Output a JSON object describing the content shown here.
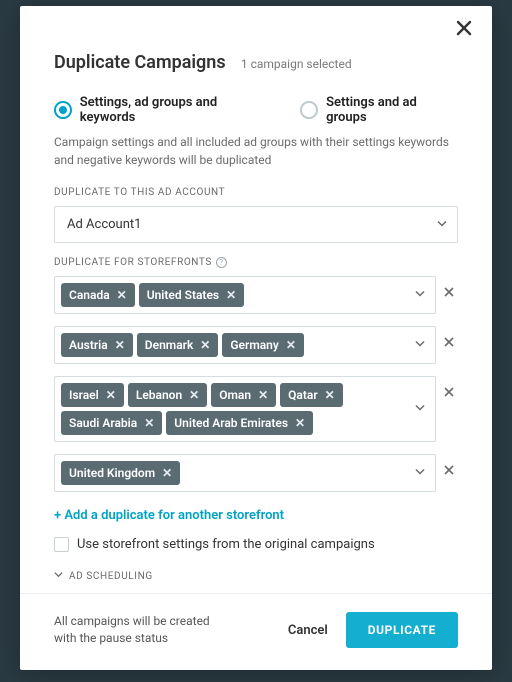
{
  "header": {
    "title": "Duplicate Campaigns",
    "subtitle": "1 campaign selected"
  },
  "radio": {
    "opt1": "Settings, ad groups and keywords",
    "opt2": "Settings and ad groups"
  },
  "description": "Campaign settings and all included ad groups with their settings  keywords and negative keywords will be duplicated",
  "account": {
    "label": "DUPLICATE TO THIS AD ACCOUNT",
    "value": "Ad Account1"
  },
  "storefronts": {
    "label": "DUPLICATE FOR STOREFRONTS",
    "rows": [
      [
        "Canada",
        "United States"
      ],
      [
        "Austria",
        "Denmark",
        "Germany"
      ],
      [
        "Israel",
        "Lebanon",
        "Oman",
        "Qatar",
        "Saudi Arabia",
        "United Arab Emirates"
      ],
      [
        "United Kingdom"
      ]
    ]
  },
  "add_link": "+ Add a duplicate for another storefront",
  "checkbox_label": "Use storefront settings from the original campaigns",
  "scheduling_label": "AD SCHEDULING",
  "footer": {
    "note": "All campaigns will be created with the pause status",
    "cancel": "Cancel",
    "submit": "DUPLICATE"
  }
}
